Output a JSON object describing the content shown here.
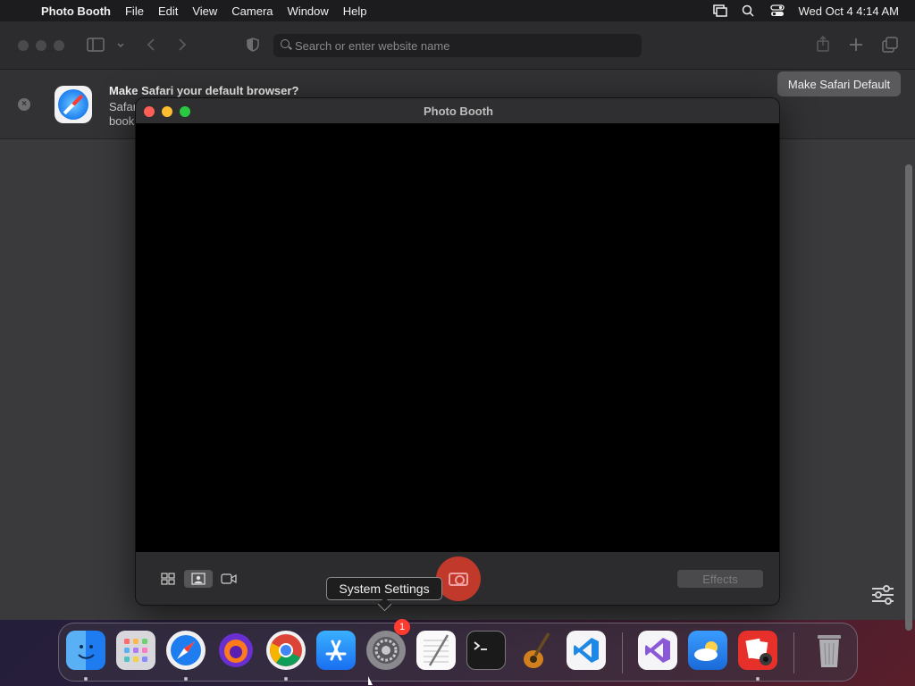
{
  "menubar": {
    "app_name": "Photo Booth",
    "menus": [
      "File",
      "Edit",
      "View",
      "Camera",
      "Window",
      "Help"
    ],
    "clock": "Wed Oct 4  4:14 AM"
  },
  "safari": {
    "address_placeholder": "Search or enter website name",
    "banner": {
      "title": "Make Safari your default browser?",
      "description_visible": "Safari book",
      "button": "Make Safari Default"
    }
  },
  "photobooth": {
    "title": "Photo Booth",
    "effects_label": "Effects",
    "mode_selected": "photo"
  },
  "tooltip": "System Settings",
  "dock": {
    "apps": [
      {
        "name": "Finder",
        "icon": "finder-icon",
        "running": true
      },
      {
        "name": "Launchpad",
        "icon": "launchpad-icon",
        "running": false
      },
      {
        "name": "Safari",
        "icon": "safari-icon",
        "running": true
      },
      {
        "name": "Firefox",
        "icon": "firefox-icon",
        "running": false
      },
      {
        "name": "Chrome",
        "icon": "chrome-icon",
        "running": true
      },
      {
        "name": "App Store",
        "icon": "app-store-icon",
        "running": false
      },
      {
        "name": "System Settings",
        "icon": "system-settings-icon",
        "running": false,
        "badge": "1"
      },
      {
        "name": "TextEdit",
        "icon": "textedit-icon",
        "running": false
      },
      {
        "name": "Terminal",
        "icon": "terminal-icon",
        "running": false
      },
      {
        "name": "GarageBand",
        "icon": "garageband-icon",
        "running": false
      },
      {
        "name": "VS Code",
        "icon": "vscode-icon",
        "running": false
      },
      {
        "name": "Visual Studio",
        "icon": "visual-studio-icon",
        "running": false
      },
      {
        "name": "Weather",
        "icon": "weather-icon",
        "running": false
      },
      {
        "name": "Photo Booth",
        "icon": "photo-booth-icon",
        "running": true
      },
      {
        "name": "Trash",
        "icon": "trash-icon",
        "running": false
      }
    ]
  },
  "colors": {
    "accent_red": "#ff3b30",
    "capture_button": "#c0392b"
  }
}
